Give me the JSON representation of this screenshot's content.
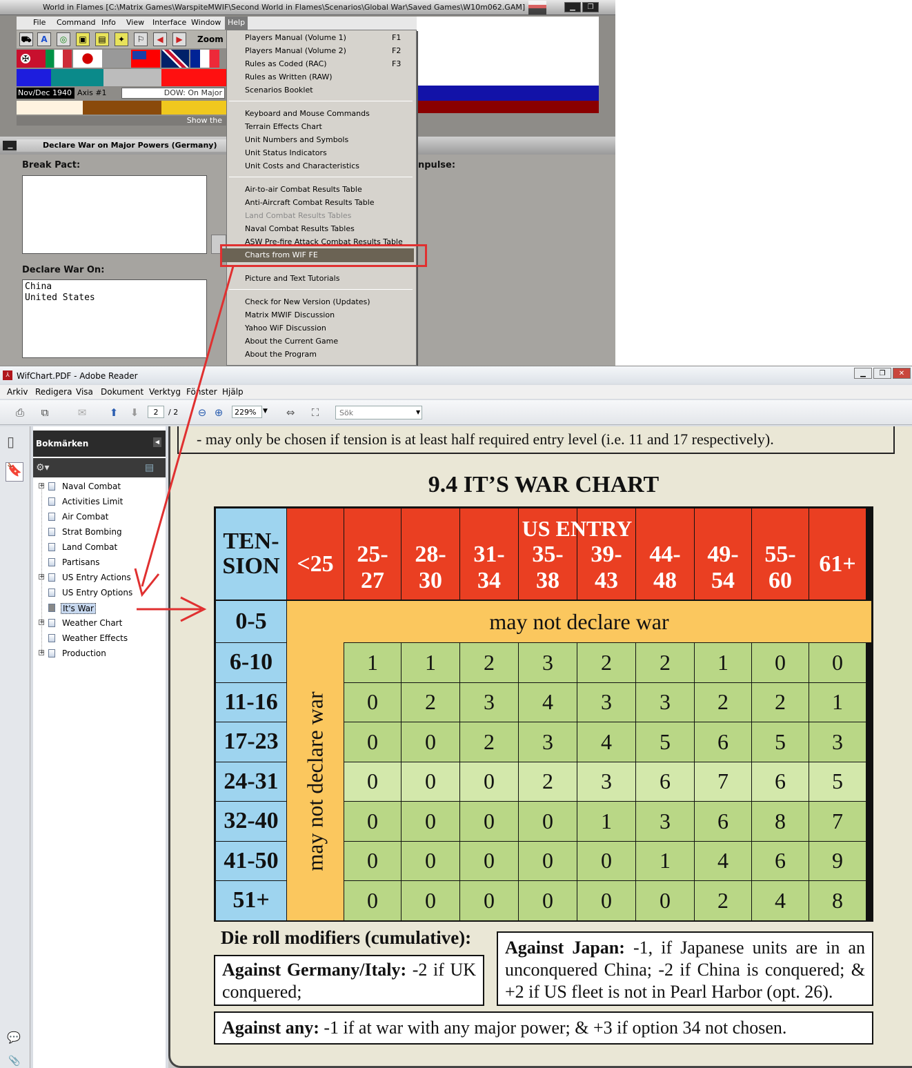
{
  "wif": {
    "title": "World in Flames [C:\\Matrix Games\\WarspiteMWIF\\Second World in Flames\\Scenarios\\Global War\\Saved Games\\W10m062.GAM]",
    "menu": [
      "File",
      "Command",
      "Info",
      "View",
      "Interface",
      "Window",
      "Help"
    ],
    "zoom_label": "Zoom",
    "turn": "Nov/Dec 1940",
    "axis": "Axis #1",
    "dow_field": "DOW: On Major",
    "show_text": "Show the",
    "dialog_title": "Declare War on Major Powers (Germany)",
    "break_pact_label": "Break Pact:",
    "declare_war_label": "Declare War On:",
    "declare_war_list": [
      "China",
      "United States"
    ],
    "impulse_label": "npulse:"
  },
  "help_menu": {
    "groups": [
      [
        {
          "label": "Players Manual (Volume 1)",
          "key": "F1"
        },
        {
          "label": "Players Manual (Volume 2)",
          "key": "F2"
        },
        {
          "label": "Rules as Coded (RAC)",
          "key": "F3"
        },
        {
          "label": "Rules as Written (RAW)",
          "key": ""
        },
        {
          "label": "Scenarios Booklet",
          "key": ""
        }
      ],
      [
        {
          "label": "Keyboard and Mouse Commands",
          "key": ""
        },
        {
          "label": "Terrain Effects Chart",
          "key": ""
        },
        {
          "label": "Unit Numbers and Symbols",
          "key": ""
        },
        {
          "label": "Unit Status Indicators",
          "key": ""
        },
        {
          "label": "Unit Costs and Characteristics",
          "key": ""
        }
      ],
      [
        {
          "label": "Air-to-air Combat Results Table",
          "key": ""
        },
        {
          "label": "Anti-Aircraft Combat Results Table",
          "key": ""
        },
        {
          "label": "Land Combat Results Tables",
          "key": "",
          "disabled": true
        },
        {
          "label": "Naval Combat Results Tables",
          "key": ""
        },
        {
          "label": "ASW Pre-fire Attack Combat Results Table",
          "key": ""
        },
        {
          "label": "Charts from WIF FE",
          "key": "",
          "highlighted": true
        }
      ],
      [
        {
          "label": "Picture and Text Tutorials",
          "key": ""
        }
      ],
      [
        {
          "label": "Check for New Version (Updates)",
          "key": ""
        },
        {
          "label": "Matrix MWIF Discussion",
          "key": ""
        },
        {
          "label": "Yahoo WiF Discussion",
          "key": ""
        },
        {
          "label": "About the Current Game",
          "key": ""
        },
        {
          "label": "About the Program",
          "key": ""
        }
      ]
    ]
  },
  "reader": {
    "title": "WifChart.PDF - Adobe Reader",
    "menu": [
      "Arkiv",
      "Redigera",
      "Visa",
      "Dokument",
      "Verktyg",
      "Fönster",
      "Hjälp"
    ],
    "page_current": "2",
    "page_total": "/ 2",
    "zoom": "229%",
    "search_placeholder": "Sök",
    "bookmarks_title": "Bokmärken",
    "bookmarks": [
      {
        "label": "Naval Combat",
        "expandable": true
      },
      {
        "label": "Activities Limit",
        "expandable": false
      },
      {
        "label": "Air Combat",
        "expandable": false
      },
      {
        "label": "Strat Bombing",
        "expandable": false
      },
      {
        "label": "Land Combat",
        "expandable": false
      },
      {
        "label": "Partisans",
        "expandable": false
      },
      {
        "label": "US Entry Actions",
        "expandable": true
      },
      {
        "label": "US Entry Options",
        "expandable": false
      },
      {
        "label": "It's War",
        "expandable": false,
        "selected": true
      },
      {
        "label": "Weather Chart",
        "expandable": true
      },
      {
        "label": "Weather Effects",
        "expandable": false
      },
      {
        "label": "Production",
        "expandable": true
      }
    ]
  },
  "document": {
    "prev_note": "- may only be chosen if tension is at least half required entry level (i.e. 11  and 17 respectively).",
    "chart_title": "9.4   IT’S WAR CHART",
    "tension_header": [
      "TEN-",
      "SION"
    ],
    "us_entry_header": "US ENTRY",
    "columns": [
      "<25",
      "25-27",
      "28-30",
      "31-34",
      "35-38",
      "39-43",
      "44-48",
      "49-54",
      "55-60",
      "61+"
    ],
    "column_lines": [
      [
        "<25"
      ],
      [
        "25-",
        "27"
      ],
      [
        "28-",
        "30"
      ],
      [
        "31-",
        "34"
      ],
      [
        "35-",
        "38"
      ],
      [
        "39-",
        "43"
      ],
      [
        "44-",
        "48"
      ],
      [
        "49-",
        "54"
      ],
      [
        "55-",
        "60"
      ],
      [
        "61+"
      ]
    ],
    "rows": [
      "0-5",
      "6-10",
      "11-16",
      "17-23",
      "24-31",
      "32-40",
      "41-50",
      "51+"
    ],
    "no_war_text": "may not declare war",
    "values": [
      [
        1,
        1,
        2,
        3,
        2,
        2,
        1,
        0,
        0
      ],
      [
        0,
        2,
        3,
        4,
        3,
        3,
        2,
        2,
        1
      ],
      [
        0,
        0,
        2,
        3,
        4,
        5,
        6,
        5,
        3
      ],
      [
        0,
        0,
        0,
        2,
        3,
        6,
        7,
        6,
        5
      ],
      [
        0,
        0,
        0,
        0,
        1,
        3,
        6,
        8,
        7
      ],
      [
        0,
        0,
        0,
        0,
        0,
        1,
        4,
        6,
        9
      ],
      [
        0,
        0,
        0,
        0,
        0,
        0,
        2,
        4,
        8
      ]
    ],
    "modifiers_title": "Die roll modifiers (cumulative):",
    "mod_germany_label": "Against Germany/Italy:",
    "mod_germany_text": " -2 if UK conquered;",
    "mod_japan_label": "Against Japan:",
    "mod_japan_text": " -1, if Japanese units are in an unconquered China; -2 if China is conquered; & +2 if US fleet is not in Pearl Harbor (opt. 26).",
    "mod_any_label": "Against any:",
    "mod_any_text": "  -1 if at war with any major power; & +3 if option 34 not chosen."
  },
  "colors": {
    "annotation_red": "#e03030",
    "tension_blue": "#9ed4ef",
    "header_red": "#ea3f22",
    "orange": "#fbc75e",
    "green": "#b9d786",
    "light_green": "#d3e8ab"
  }
}
